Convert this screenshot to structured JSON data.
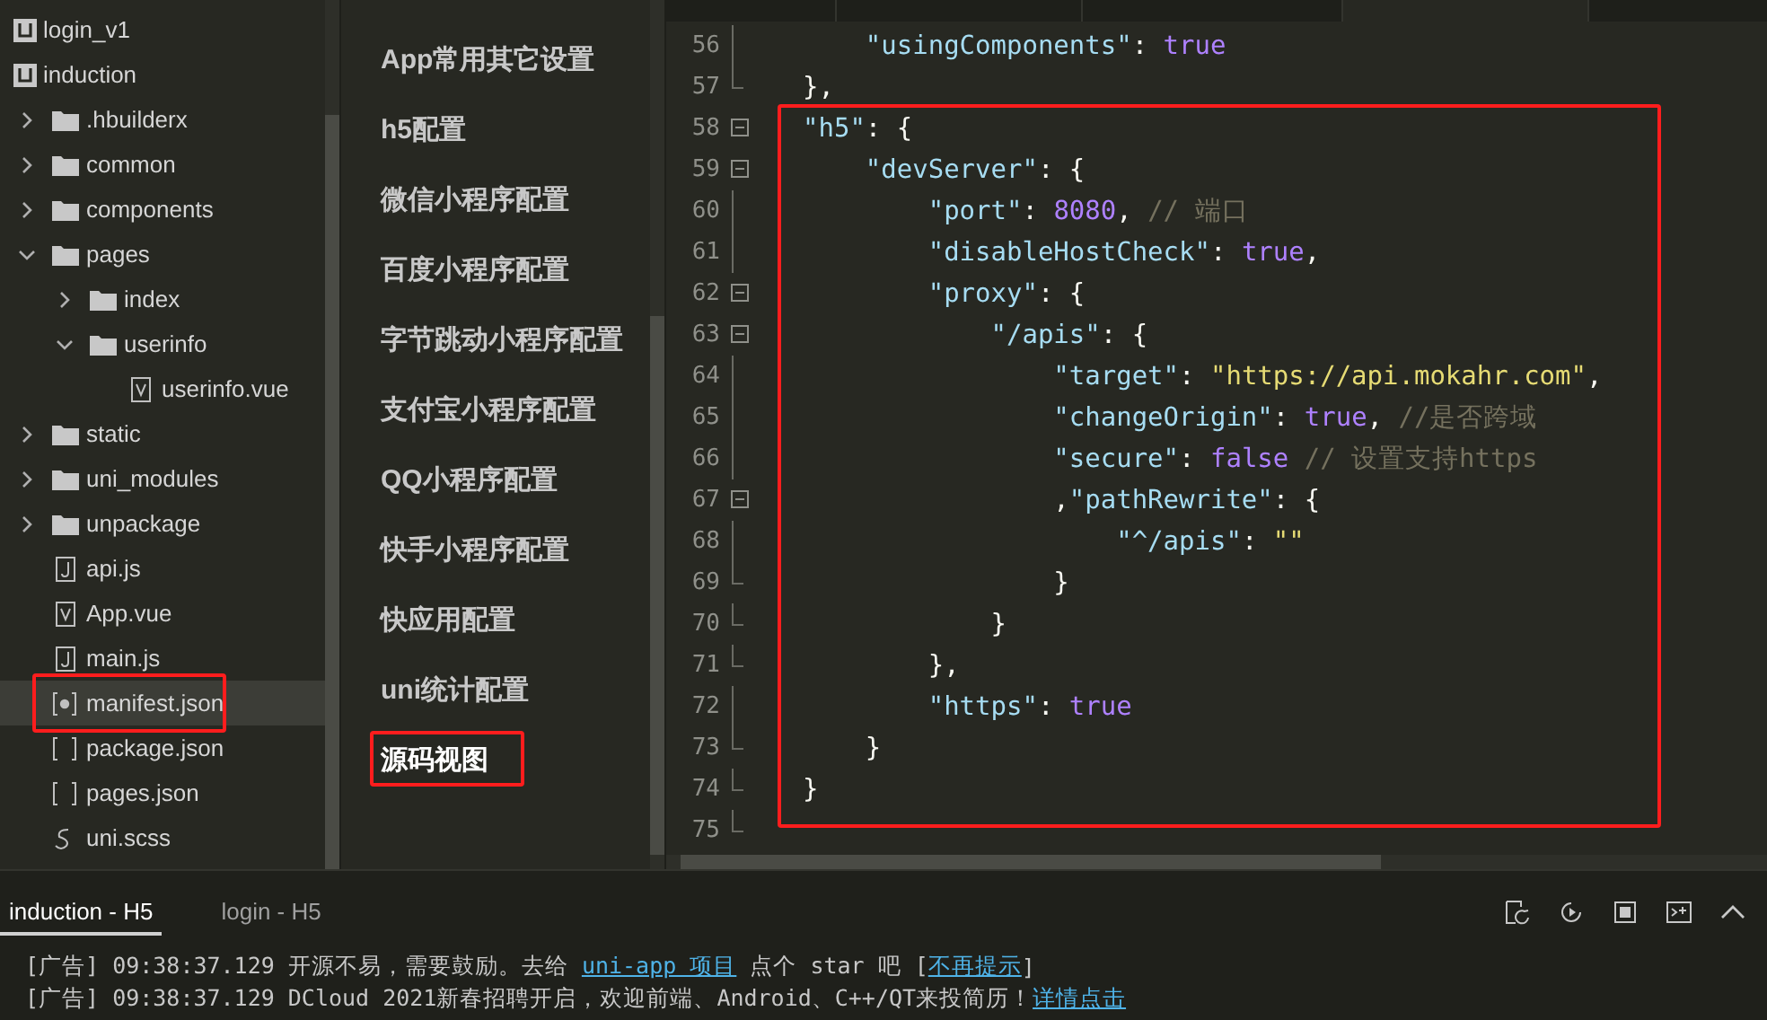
{
  "file_tree": [
    {
      "label": "login_v1",
      "kind": "project"
    },
    {
      "label": "induction",
      "kind": "project",
      "children": [
        {
          "label": ".hbuilderx",
          "kind": "folder",
          "expanded": false
        },
        {
          "label": "common",
          "kind": "folder",
          "expanded": false
        },
        {
          "label": "components",
          "kind": "folder",
          "expanded": false
        },
        {
          "label": "pages",
          "kind": "folder",
          "expanded": true,
          "children": [
            {
              "label": "index",
              "kind": "folder",
              "expanded": false
            },
            {
              "label": "userinfo",
              "kind": "folder",
              "expanded": true,
              "children": [
                {
                  "label": "userinfo.vue",
                  "kind": "vue",
                  "selected": false,
                  "highlighted": false
                }
              ]
            }
          ]
        },
        {
          "label": "static",
          "kind": "folder",
          "expanded": false
        },
        {
          "label": "uni_modules",
          "kind": "folder",
          "expanded": false
        },
        {
          "label": "unpackage",
          "kind": "folder",
          "expanded": false
        },
        {
          "label": "api.js",
          "kind": "script",
          "selected": false,
          "highlighted": false
        },
        {
          "label": "App.vue",
          "kind": "vue",
          "selected": false,
          "highlighted": false
        },
        {
          "label": "main.js",
          "kind": "script",
          "selected": false,
          "highlighted": false
        },
        {
          "label": "manifest.json",
          "kind": "config",
          "selected": true,
          "highlighted": true
        },
        {
          "label": "package.json",
          "kind": "json",
          "selected": false,
          "highlighted": false
        },
        {
          "label": "pages.json",
          "kind": "json",
          "selected": false,
          "highlighted": false
        },
        {
          "label": "uni.scss",
          "kind": "style",
          "selected": false,
          "highlighted": false
        }
      ]
    }
  ],
  "settings_nav": [
    {
      "label": "App常用其它设置",
      "selected": false,
      "highlighted": false
    },
    {
      "label": "h5配置",
      "selected": false,
      "highlighted": false
    },
    {
      "label": "微信小程序配置",
      "selected": false,
      "highlighted": false
    },
    {
      "label": "百度小程序配置",
      "selected": false,
      "highlighted": false
    },
    {
      "label": "字节跳动小程序配置",
      "selected": false,
      "highlighted": false
    },
    {
      "label": "支付宝小程序配置",
      "selected": false,
      "highlighted": false
    },
    {
      "label": "QQ小程序配置",
      "selected": false,
      "highlighted": false
    },
    {
      "label": "快手小程序配置",
      "selected": false,
      "highlighted": false
    },
    {
      "label": "快应用配置",
      "selected": false,
      "highlighted": false
    },
    {
      "label": "uni统计配置",
      "selected": false,
      "highlighted": false
    },
    {
      "label": "源码视图",
      "selected": true,
      "highlighted": true
    }
  ],
  "editor": {
    "blocks": [
      {
        "highlighted": false,
        "lines": [
          {
            "number": "56",
            "fold_start": false,
            "fold_end": false,
            "segments": [
              {
                "kind": "key",
                "text": "    \"usingComponents\""
              },
              {
                "kind": "plain",
                "text": ": "
              },
              {
                "kind": "keyword",
                "text": "true"
              }
            ]
          },
          {
            "number": "57",
            "fold_start": false,
            "fold_end": true,
            "segments": [
              {
                "kind": "plain",
                "text": "},"
              }
            ]
          }
        ]
      },
      {
        "highlighted": true,
        "lines": [
          {
            "number": "58",
            "fold_start": true,
            "fold_end": false,
            "segments": [
              {
                "kind": "key",
                "text": "\"h5\""
              },
              {
                "kind": "plain",
                "text": ": {"
              }
            ]
          },
          {
            "number": "59",
            "fold_start": true,
            "fold_end": false,
            "segments": [
              {
                "kind": "key",
                "text": "    \"devServer\""
              },
              {
                "kind": "plain",
                "text": ": {"
              }
            ]
          },
          {
            "number": "60",
            "fold_start": false,
            "fold_end": false,
            "segments": [
              {
                "kind": "key",
                "text": "        \"port\""
              },
              {
                "kind": "plain",
                "text": ": "
              },
              {
                "kind": "number",
                "text": "8080"
              },
              {
                "kind": "plain",
                "text": ", "
              },
              {
                "kind": "comment",
                "text": "// 端口"
              }
            ]
          },
          {
            "number": "61",
            "fold_start": false,
            "fold_end": false,
            "segments": [
              {
                "kind": "key",
                "text": "        \"disableHostCheck\""
              },
              {
                "kind": "plain",
                "text": ": "
              },
              {
                "kind": "keyword",
                "text": "true"
              },
              {
                "kind": "plain",
                "text": ","
              }
            ]
          },
          {
            "number": "62",
            "fold_start": true,
            "fold_end": false,
            "segments": [
              {
                "kind": "key",
                "text": "        \"proxy\""
              },
              {
                "kind": "plain",
                "text": ": {"
              }
            ]
          },
          {
            "number": "63",
            "fold_start": true,
            "fold_end": false,
            "segments": [
              {
                "kind": "key",
                "text": "            \"/apis\""
              },
              {
                "kind": "plain",
                "text": ": {"
              }
            ]
          },
          {
            "number": "64",
            "fold_start": false,
            "fold_end": false,
            "segments": [
              {
                "kind": "key",
                "text": "                \"target\""
              },
              {
                "kind": "plain",
                "text": ": "
              },
              {
                "kind": "string",
                "text": "\"https://api.mokahr.com\""
              },
              {
                "kind": "plain",
                "text": ","
              }
            ]
          },
          {
            "number": "65",
            "fold_start": false,
            "fold_end": false,
            "segments": [
              {
                "kind": "key",
                "text": "                \"changeOrigin\""
              },
              {
                "kind": "plain",
                "text": ": "
              },
              {
                "kind": "keyword",
                "text": "true"
              },
              {
                "kind": "plain",
                "text": ", "
              },
              {
                "kind": "comment",
                "text": "//是否跨域"
              }
            ]
          },
          {
            "number": "66",
            "fold_start": false,
            "fold_end": false,
            "segments": [
              {
                "kind": "key",
                "text": "                \"secure\""
              },
              {
                "kind": "plain",
                "text": ": "
              },
              {
                "kind": "keyword",
                "text": "false"
              },
              {
                "kind": "comment",
                "text": " // 设置支持https"
              }
            ]
          },
          {
            "number": "67",
            "fold_start": true,
            "fold_end": false,
            "segments": [
              {
                "kind": "plain",
                "text": "                ,"
              },
              {
                "kind": "key",
                "text": "\"pathRewrite\""
              },
              {
                "kind": "plain",
                "text": ": {"
              }
            ]
          },
          {
            "number": "68",
            "fold_start": false,
            "fold_end": false,
            "segments": [
              {
                "kind": "key",
                "text": "                    \"^/apis\""
              },
              {
                "kind": "plain",
                "text": ": "
              },
              {
                "kind": "string",
                "text": "\"\""
              }
            ]
          },
          {
            "number": "69",
            "fold_start": false,
            "fold_end": true,
            "segments": [
              {
                "kind": "plain",
                "text": "                }"
              }
            ]
          },
          {
            "number": "70",
            "fold_start": false,
            "fold_end": true,
            "segments": [
              {
                "kind": "plain",
                "text": "            }"
              }
            ]
          },
          {
            "number": "71",
            "fold_start": false,
            "fold_end": true,
            "segments": [
              {
                "kind": "plain",
                "text": "        },"
              }
            ]
          },
          {
            "number": "72",
            "fold_start": false,
            "fold_end": false,
            "segments": [
              {
                "kind": "key",
                "text": "        \"https\""
              },
              {
                "kind": "plain",
                "text": ": "
              },
              {
                "kind": "keyword",
                "text": "true"
              }
            ]
          },
          {
            "number": "73",
            "fold_start": false,
            "fold_end": true,
            "segments": [
              {
                "kind": "plain",
                "text": "    }"
              }
            ]
          },
          {
            "number": "74",
            "fold_start": false,
            "fold_end": true,
            "segments": [
              {
                "kind": "plain",
                "text": "}"
              }
            ]
          }
        ]
      },
      {
        "highlighted": false,
        "lines": [
          {
            "number": "75",
            "fold_start": false,
            "fold_end": true
          }
        ]
      }
    ]
  },
  "console": {
    "tabs": [
      {
        "label": "induction - H5",
        "selected": true
      },
      {
        "label": "login - H5",
        "selected": false
      }
    ],
    "messages": [
      {
        "segments": [
          {
            "kind": "plain",
            "text": "[广告] 09:38:37.129 开源不易，需要鼓励。去给 "
          },
          {
            "kind": "link",
            "text": "uni-app 项目"
          },
          {
            "kind": "plain",
            "text": " 点个 star 吧 ["
          },
          {
            "kind": "link",
            "text": "不再提示"
          },
          {
            "kind": "plain",
            "text": "]"
          }
        ]
      },
      {
        "segments": [
          {
            "kind": "plain",
            "text": "[广告] 09:38:37.129 DCloud 2021新春招聘开启，欢迎前端、Android、C++/QT来投简历！"
          },
          {
            "kind": "link",
            "text": "详情点击"
          }
        ]
      }
    ]
  }
}
